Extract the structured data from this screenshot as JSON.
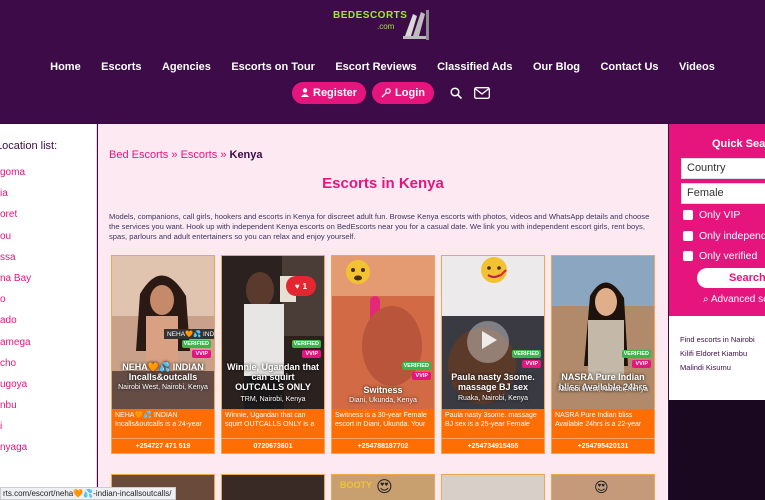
{
  "brand": {
    "name": "BEDESCORTS",
    "tld": ".com"
  },
  "nav": [
    "Home",
    "Escorts",
    "Agencies",
    "Escorts on Tour",
    "Escort Reviews",
    "Classified Ads",
    "Our Blog",
    "Contact Us",
    "Videos"
  ],
  "actions": {
    "register": "Register",
    "login": "Login"
  },
  "left_sidebar": {
    "title": "Location list:",
    "items": [
      "goma",
      "ia",
      "oret",
      "ou",
      "ssa",
      "na Bay",
      "o",
      "ado",
      "amega",
      "cho",
      "ugoya",
      "nbu",
      "i",
      "nyaga"
    ]
  },
  "breadcrumb": {
    "a": "Bed Escorts",
    "sep": "»",
    "b": "Escorts",
    "current": "Kenya"
  },
  "page_title": "Escorts in Kenya",
  "intro": "Models, companions, call girls, hookers and escorts in Kenya for discreet adult fun. Browse Kenya escorts with photos, videos and WhatsApp details and choose the services you want. Hook up with independent Kenya escorts on BedEscorts near you for a casual date. We link you with independent escort girls, rent boys, spas, parlours and adult entertainers so you can relax and enjoy yourself.",
  "cards": [
    {
      "name": "NEHA🧡💦 INDIAN Incalls&outcalls",
      "location": "Nairobi West, Nairobi, Kenya",
      "verified": "VERIFIED",
      "vip": "VVIP",
      "tooltip": "NEHA🧡💦 INDIAN Incalls&outcalls",
      "desc": "NEHA🧡💦 INDIAN Incalls&outcalls is a 24-year",
      "phone": "+254727 471 519"
    },
    {
      "name": "Winnie, Ugandan that can squirt OUTCALLS ONLY",
      "location": "TRM, Nairobi, Kenya",
      "verified": "VERIFIED",
      "vip": "VVIP",
      "likes": "1",
      "desc": "Winnie, Ugandan that can squirt OUTCALLS ONLY is a",
      "phone": "0720673601"
    },
    {
      "name": "Switness",
      "location": "Diani, Ukunda, Kenya",
      "verified": "VERIFIED",
      "vip": "VVIP",
      "desc": "Switness is a 30-year Female escort in Diani, Ukunda. Your",
      "phone": "+254788187702"
    },
    {
      "name": "Paula nasty 3some. massage BJ sex",
      "location": "Ruaka, Nairobi, Kenya",
      "verified": "VERIFIED",
      "vip": "VVIP",
      "desc": "Paula nasty 3some. massage BJ sex is a 25-year Female",
      "phone": "+254734915455"
    },
    {
      "name": "NASRA Pure Indian bliss Available 24hrs",
      "location": "Nairobi West, Nairobi, Kenya",
      "verified": "VERIFIED",
      "vip": "VVIP",
      "desc": "NASRA Pure Indian bliss Available 24hrs is a 22-year",
      "phone": "+254795420131"
    }
  ],
  "second_row_label": "BOOTY",
  "quick_search": {
    "title": "Quick Search",
    "country": "Country",
    "gender": "Female",
    "checks": [
      "Only VIP",
      "Only independent",
      "Only verified"
    ],
    "search": "Search",
    "advanced": "Advanced search"
  },
  "find": {
    "label": "Find escorts in",
    "cities": [
      "Nairobi",
      "Kilifi",
      "Eldoret",
      "Kiambu",
      "Malindi",
      "Kisumu"
    ]
  },
  "status_url": "rts.com/escort/neha🧡💦-indian-incallsoutcalls/"
}
